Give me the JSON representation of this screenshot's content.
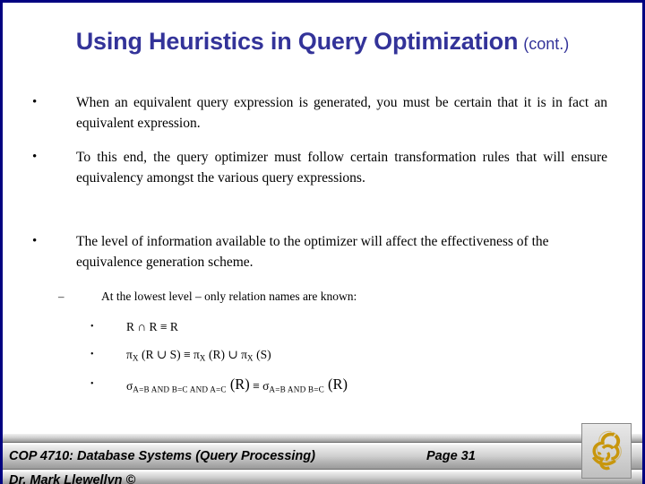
{
  "slide": {
    "title_main": "Using Heuristics in Query Optimization",
    "title_cont": "(cont.)",
    "title_color": "#333399",
    "border_color": "#000080",
    "background": "#ffffff"
  },
  "bullets": [
    {
      "marker": "•",
      "level": 1,
      "text": "When an equivalent query expression is generated, you must be certain that it is in fact an equivalent expression."
    },
    {
      "marker": "•",
      "level": 1,
      "text": "To this end, the query optimizer must follow certain transformation rules that will ensure equivalency amongst the various query expressions."
    },
    {
      "marker": "•",
      "level": 1,
      "text": "The level of information available to the optimizer will affect the effectiveness of the equivalence generation scheme."
    },
    {
      "marker": "–",
      "level": 2,
      "text": "At the lowest level – only relation names are known:"
    }
  ],
  "formulas": [
    {
      "marker": "•",
      "plain": "R ∩ R ≡ R",
      "parts": [
        {
          "t": "R ∩ R ≡ R",
          "style": "normal"
        }
      ]
    },
    {
      "marker": "•",
      "plain": "πX (R ∪ S) ≡ πX (R) ∪ πX (S)",
      "parts": [
        {
          "t": "π",
          "style": "normal"
        },
        {
          "t": "X",
          "style": "sub"
        },
        {
          "t": " (R ∪ S) ≡ ",
          "style": "normal"
        },
        {
          "t": "π",
          "style": "normal"
        },
        {
          "t": "X",
          "style": "sub"
        },
        {
          "t": " (R)  ∪  ",
          "style": "normal"
        },
        {
          "t": "π",
          "style": "normal"
        },
        {
          "t": "X",
          "style": "sub"
        },
        {
          "t": " (S)",
          "style": "normal"
        }
      ]
    },
    {
      "marker": "•",
      "plain": "σA=B AND B=C AND A=C (R) ≡ σA=B AND B=C (R)",
      "parts": [
        {
          "t": "σ",
          "style": "normal"
        },
        {
          "t": "A=B AND B=C AND A=C",
          "style": "sub"
        },
        {
          "t": " (R)",
          "style": "big"
        },
        {
          "t": " ≡ ",
          "style": "normal"
        },
        {
          "t": "σ",
          "style": "normal"
        },
        {
          "t": "A=B AND B=C",
          "style": "sub"
        },
        {
          "t": " (R)",
          "style": "big"
        }
      ]
    }
  ],
  "footer": {
    "course": "COP 4710: Database Systems (Query Processing)",
    "page": "Page 31",
    "author": "Dr. Mark Llewellyn ©",
    "logo_name": "ucf-pegasus-logo",
    "logo_color": "#C8960C"
  }
}
